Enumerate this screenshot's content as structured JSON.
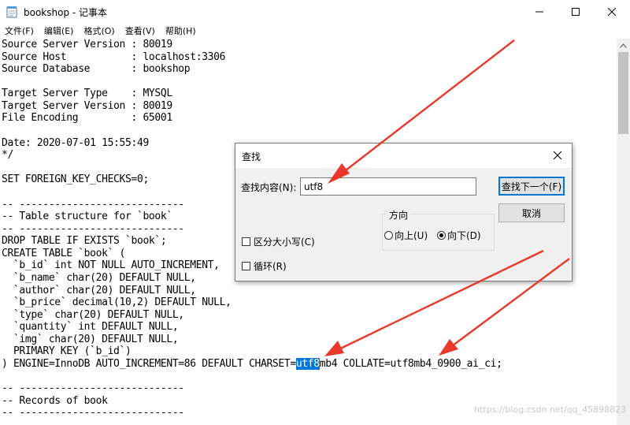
{
  "window": {
    "title": "bookshop - 记事本",
    "menu": [
      "文件(F)",
      "编辑(E)",
      "格式(O)",
      "查看(V)",
      "帮助(H)"
    ]
  },
  "editor": {
    "lines": [
      {
        "text": "Source Server Version : 80019"
      },
      {
        "text": "Source Host           : localhost:3306"
      },
      {
        "text": "Source Database       : bookshop"
      },
      {
        "text": ""
      },
      {
        "text": "Target Server Type    : MYSQL"
      },
      {
        "text": "Target Server Version : 80019"
      },
      {
        "text": "File Encoding         : 65001"
      },
      {
        "text": ""
      },
      {
        "text": "Date: 2020-07-01 15:55:49"
      },
      {
        "text": "*/"
      },
      {
        "text": ""
      },
      {
        "text": "SET FOREIGN_KEY_CHECKS=0;"
      },
      {
        "text": ""
      },
      {
        "text": "-- ----------------------------"
      },
      {
        "text": "-- Table structure for `book`"
      },
      {
        "text": "-- ----------------------------"
      },
      {
        "text": "DROP TABLE IF EXISTS `book`;"
      },
      {
        "text": "CREATE TABLE `book` ("
      },
      {
        "text": "  `b_id` int NOT NULL AUTO_INCREMENT,"
      },
      {
        "text": "  `b_name` char(20) DEFAULT NULL,"
      },
      {
        "text": "  `author` char(20) DEFAULT NULL,"
      },
      {
        "text": "  `b_price` decimal(10,2) DEFAULT NULL,"
      },
      {
        "text": "  `type` char(20) DEFAULT NULL,"
      },
      {
        "text": "  `quantity` int DEFAULT NULL,"
      },
      {
        "text": "  `img` char(20) DEFAULT NULL,"
      },
      {
        "text": "  PRIMARY KEY (`b_id`)"
      },
      {
        "pre": ") ENGINE=InnoDB AUTO_INCREMENT=86 DEFAULT CHARSET=",
        "match": "utf8",
        "post": "mb4 COLLATE=utf8mb4_0900_ai_ci;"
      },
      {
        "text": ""
      },
      {
        "text": "-- ----------------------------"
      },
      {
        "text": "-- Records of book"
      },
      {
        "text": "-- ----------------------------"
      }
    ]
  },
  "find_dialog": {
    "title": "查找",
    "find_label": "查找内容(N):",
    "find_value": "utf8",
    "find_next_label": "查找下一个(F)",
    "cancel_label": "取消",
    "direction_label": "方向",
    "direction_up_label": "向上(U)",
    "direction_down_label": "向下(D)",
    "direction_selected": "down",
    "match_case_label": "区分大小写(C)",
    "match_case_checked": false,
    "wrap_label": "循环(R)",
    "wrap_checked": false
  },
  "watermark": "https://blog.csdn.net/qq_45898823",
  "colors": {
    "selection": "#0078d7",
    "annotation_arrow": "#e8392a"
  }
}
